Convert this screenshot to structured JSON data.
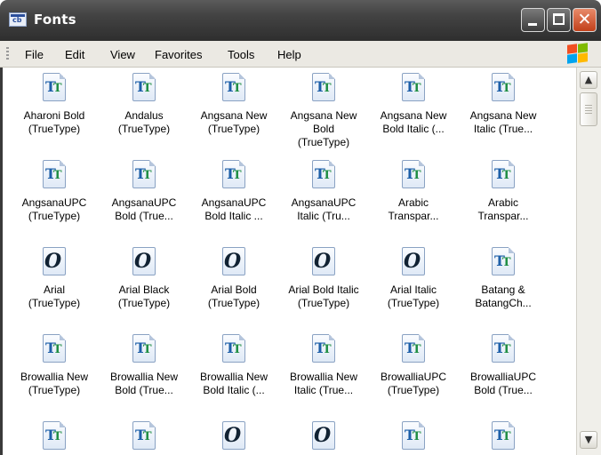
{
  "window": {
    "title": "Fonts"
  },
  "menu": [
    "File",
    "Edit",
    "View",
    "Favorites",
    "Tools",
    "Help"
  ],
  "scrollbar": {
    "up_glyph": "▲",
    "down_glyph": "▼"
  },
  "fonts": [
    {
      "label": "Aharoni Bold\n(TrueType)",
      "icon": "truetype-font-icon"
    },
    {
      "label": "Andalus\n(TrueType)",
      "icon": "truetype-font-icon"
    },
    {
      "label": "Angsana New\n(TrueType)",
      "icon": "truetype-font-icon"
    },
    {
      "label": "Angsana New\nBold\n(TrueType)",
      "icon": "truetype-font-icon"
    },
    {
      "label": "Angsana New\nBold Italic (...",
      "icon": "truetype-font-icon"
    },
    {
      "label": "Angsana New\nItalic (True...",
      "icon": "truetype-font-icon"
    },
    {
      "label": "AngsanaUPC\n(TrueType)",
      "icon": "truetype-font-icon"
    },
    {
      "label": "AngsanaUPC\nBold (True...",
      "icon": "truetype-font-icon"
    },
    {
      "label": "AngsanaUPC\nBold Italic ...",
      "icon": "truetype-font-icon"
    },
    {
      "label": "AngsanaUPC\nItalic (Tru...",
      "icon": "truetype-font-icon"
    },
    {
      "label": "Arabic\nTranspar...",
      "icon": "truetype-font-icon"
    },
    {
      "label": "Arabic\nTranspar...",
      "icon": "truetype-font-icon"
    },
    {
      "label": "Arial\n(TrueType)",
      "icon": "opentype-font-icon"
    },
    {
      "label": "Arial Black\n(TrueType)",
      "icon": "opentype-font-icon"
    },
    {
      "label": "Arial Bold\n(TrueType)",
      "icon": "opentype-font-icon"
    },
    {
      "label": "Arial Bold Italic\n(TrueType)",
      "icon": "opentype-font-icon"
    },
    {
      "label": "Arial Italic\n(TrueType)",
      "icon": "opentype-font-icon"
    },
    {
      "label": "Batang &\nBatangCh...",
      "icon": "truetype-font-icon"
    },
    {
      "label": "Browallia New\n(TrueType)",
      "icon": "truetype-font-icon"
    },
    {
      "label": "Browallia New\nBold (True...",
      "icon": "truetype-font-icon"
    },
    {
      "label": "Browallia New\nBold Italic (...",
      "icon": "truetype-font-icon"
    },
    {
      "label": "Browallia New\nItalic (True...",
      "icon": "truetype-font-icon"
    },
    {
      "label": "BrowalliaUPC\n(TrueType)",
      "icon": "truetype-font-icon"
    },
    {
      "label": "BrowalliaUPC\nBold (True...",
      "icon": "truetype-font-icon"
    },
    {
      "label": "",
      "icon": "truetype-font-icon"
    },
    {
      "label": "",
      "icon": "truetype-font-icon"
    },
    {
      "label": "",
      "icon": "opentype-font-icon"
    },
    {
      "label": "",
      "icon": "opentype-font-icon"
    },
    {
      "label": "",
      "icon": "truetype-font-icon"
    },
    {
      "label": "",
      "icon": "truetype-font-icon"
    }
  ]
}
